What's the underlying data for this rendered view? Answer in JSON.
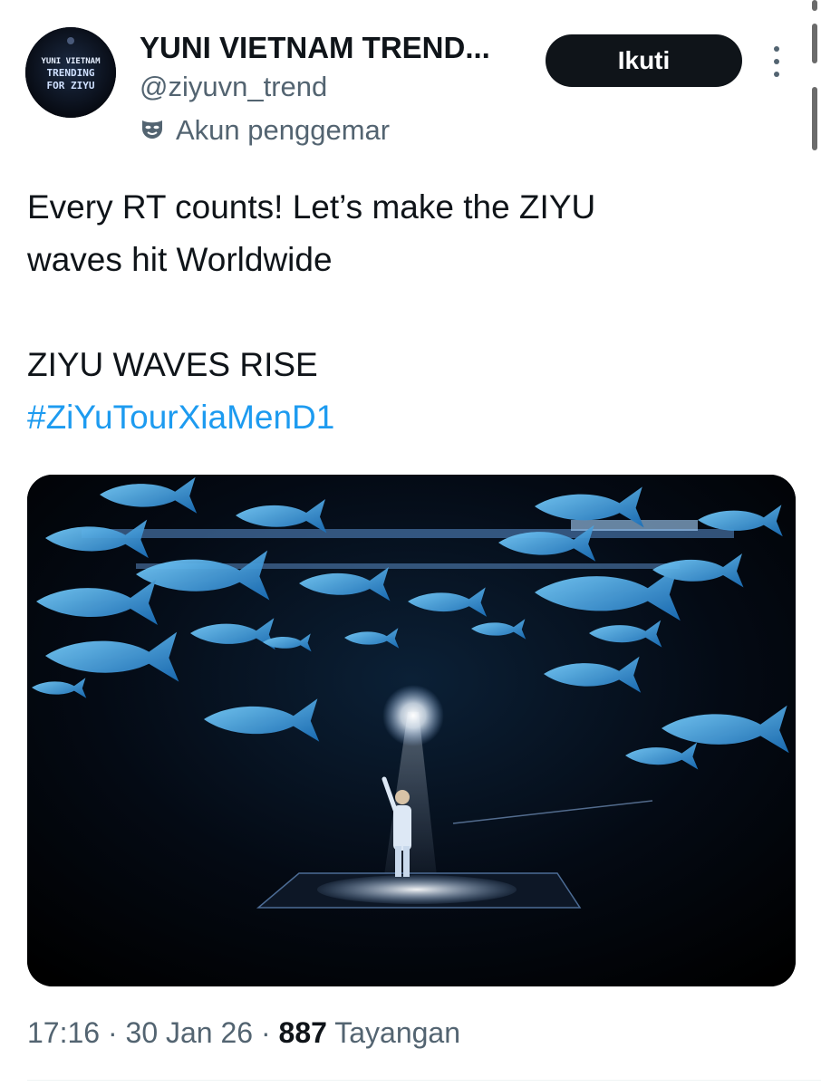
{
  "author": {
    "display_name": "YUNI VIETNAM TREND...",
    "handle": "@ziyuvn_trend",
    "badge": "Akun penggemar",
    "avatar_text": [
      "YUNI VIETNAM",
      "TRENDING",
      "FOR ZIYU"
    ]
  },
  "actions": {
    "follow_label": "Ikuti",
    "more_icon": "more-vertical-icon"
  },
  "tweet": {
    "lines": [
      "Every RT counts! Let’s make the ZIYU",
      "waves hit Worldwide",
      "ZIYU WAVES RISE"
    ],
    "hashtag": "#ZiYuTourXiaMenD1"
  },
  "meta": {
    "time": "17:16",
    "separator": "·",
    "date": "30 Jan 26",
    "views_count": "887",
    "views_label": "Tayangan"
  },
  "colors": {
    "text": "#0f1419",
    "secondary": "#536471",
    "link": "#1d9bf0",
    "button_bg": "#0f1419"
  }
}
